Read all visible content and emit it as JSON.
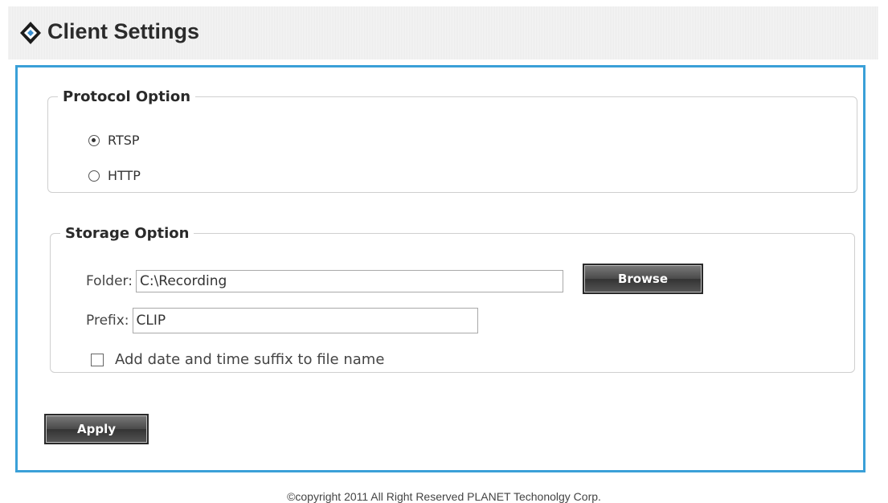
{
  "header": {
    "title": "Client Settings",
    "logo_icon": "diamond-logo-icon"
  },
  "protocol": {
    "legend": "Protocol Option",
    "options": [
      {
        "label": "RTSP",
        "checked": true
      },
      {
        "label": "HTTP",
        "checked": false
      }
    ]
  },
  "storage": {
    "legend": "Storage Option",
    "folder_label": "Folder:",
    "folder_value": "C:\\Recording",
    "browse_label": "Browse",
    "prefix_label": "Prefix:",
    "prefix_value": "CLIP",
    "suffix_label": "Add date and time suffix to file name",
    "suffix_checked": false
  },
  "actions": {
    "apply_label": "Apply"
  },
  "footer": {
    "copyright": "©copyright 2011 All Right Reserved PLANET Techonolgy Corp."
  },
  "colors": {
    "panel_border": "#3aa0d8",
    "button_dark": "#444444"
  }
}
